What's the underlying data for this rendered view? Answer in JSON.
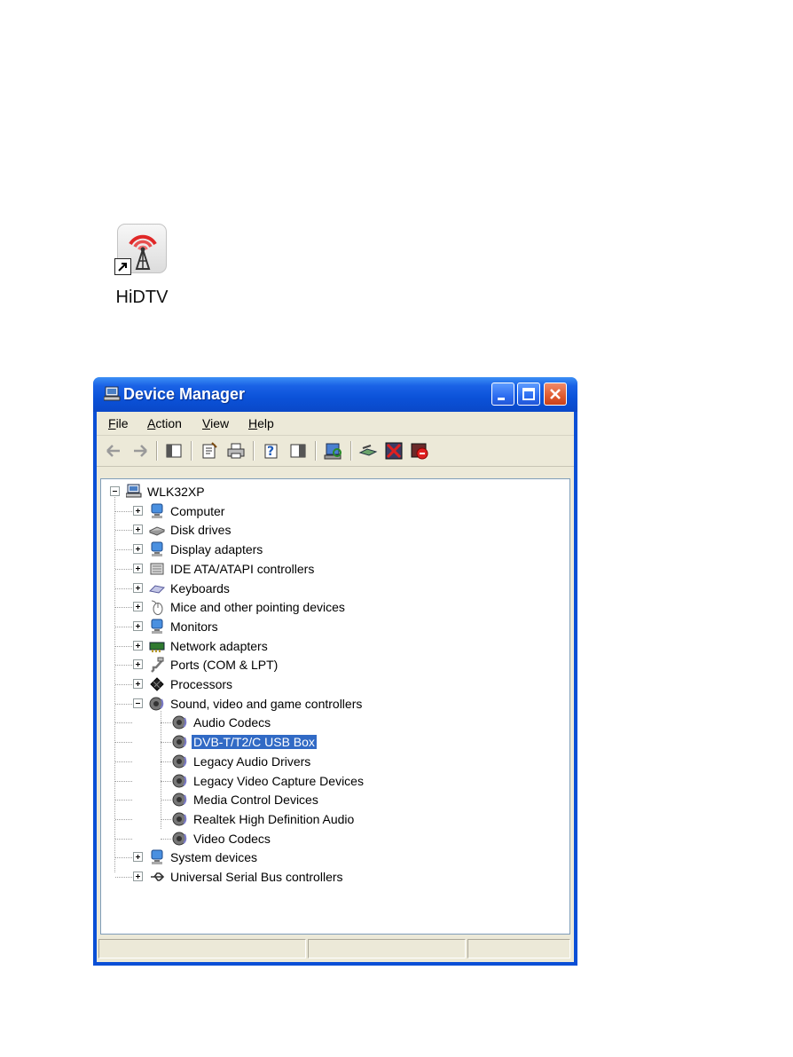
{
  "desktop": {
    "shortcut_label": "HiDTV"
  },
  "window": {
    "title": "Device Manager"
  },
  "menu": [
    "File",
    "Action",
    "View",
    "Help"
  ],
  "tree": {
    "root": "WLK32XP",
    "categories": [
      "Computer",
      "Disk drives",
      "Display adapters",
      "IDE ATA/ATAPI controllers",
      "Keyboards",
      "Mice and other pointing devices",
      "Monitors",
      "Network adapters",
      "Ports (COM & LPT)",
      "Processors",
      "Sound, video and game controllers"
    ],
    "sound_children": [
      "Audio Codecs",
      "DVB-T/T2/C USB Box",
      "Legacy Audio Drivers",
      "Legacy Video Capture Devices",
      "Media Control Devices",
      "Realtek High Definition Audio",
      "Video Codecs"
    ],
    "selected": "DVB-T/T2/C USB Box",
    "trailing_categories": [
      "System devices",
      "Universal Serial Bus controllers"
    ]
  },
  "icons": {
    "shortcut": "hidtv-antenna-icon",
    "titlebar": "device-manager-icon"
  },
  "colors": {
    "titlebar": "#0a52d8",
    "selection": "#316ac5",
    "client": "#ece9d8"
  }
}
